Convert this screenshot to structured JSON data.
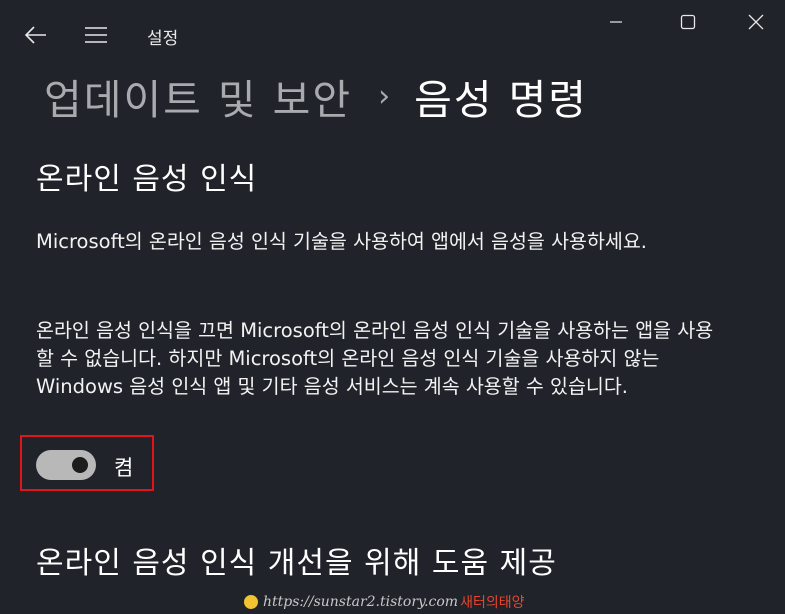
{
  "titlebar": {
    "app_title": "설정"
  },
  "breadcrumb": {
    "parent": "업데이트 및 보안",
    "separator": "›",
    "current": "음성 명령"
  },
  "section_online": {
    "heading": "온라인 음성 인식",
    "desc_1": "Microsoft의 온라인 음성 인식 기술을 사용하여 앱에서 음성을 사용하세요.",
    "desc_2": "온라인 음성 인식을 끄면 Microsoft의 온라인 음성 인식 기술을 사용하는 앱을 사용할 수 없습니다. 하지만 Microsoft의 온라인 음성 인식 기술을 사용하지 않는 Windows 음성 인식 앱 및 기타 음성 서비스는 계속 사용할 수 있습니다.",
    "toggle_state": "켬",
    "toggle_on": true
  },
  "section_improve": {
    "heading": "온라인 음성 인식 개선을 위해 도움 제공"
  },
  "watermark": {
    "url": "https://sunstar2.tistory.com",
    "name": "새터의태양"
  },
  "colors": {
    "background": "#20232a",
    "highlight": "#e0141a",
    "toggle_track": "#b8b8b8"
  }
}
